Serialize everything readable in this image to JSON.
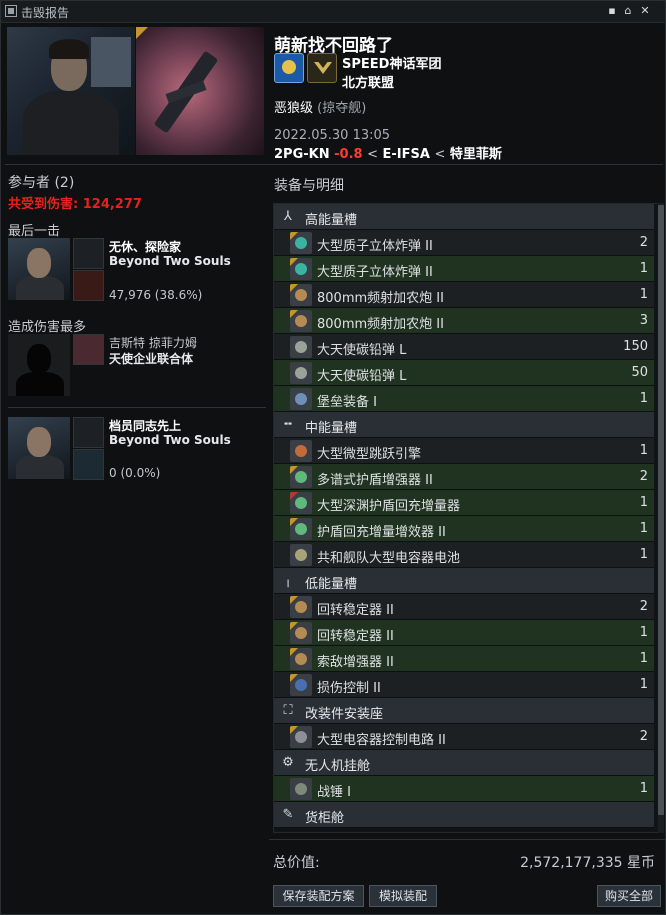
{
  "window": {
    "title": "击毁报告",
    "btn_min": "▪",
    "btn_lock": "⌂",
    "btn_close": "✕"
  },
  "victim": {
    "name": "萌新找不回路了",
    "corp": "SPEED神话军团",
    "alliance": "北方联盟",
    "ship": "恶狼级",
    "ship_class": "(掠夺舰)",
    "time": "2022.05.30 13:05",
    "system": "2PG-KN",
    "security": "-0.8",
    "region_path_1": "E-IFSA",
    "region_path_2": "特里菲斯",
    "sep": "<"
  },
  "participants": {
    "title": "参与者 (2)",
    "damage_total": "共受到伤害: 124,277",
    "final_blow_title": "最后一击",
    "final_blow": {
      "name": "无休、探险家",
      "corp": "Beyond Two Souls",
      "damage": "47,976 (38.6%)"
    },
    "top_damage_title": "造成伤害最多",
    "top_damage": {
      "name": "吉斯特 掠菲力姆",
      "corp": "天使企业联合体"
    },
    "third": {
      "name": "档员同志先上",
      "corp": "Beyond Two Souls",
      "damage": "0 (0.0%)"
    }
  },
  "fitting": {
    "title": "装备与明细",
    "sections": [
      {
        "label": "高能量槽",
        "icon": "high-slot-icon",
        "glyph": "⅄",
        "items": [
          {
            "name": "大型质子立体炸弹 II",
            "qty": "2",
            "green": false,
            "t2": true,
            "color": "#3bb3a1"
          },
          {
            "name": "大型质子立体炸弹 II",
            "qty": "1",
            "green": true,
            "t2": true,
            "color": "#3bb3a1"
          },
          {
            "name": "800mm频射加农炮 II",
            "qty": "1",
            "green": false,
            "t2": true,
            "color": "#b48a55"
          },
          {
            "name": "800mm频射加农炮 II",
            "qty": "3",
            "green": true,
            "t2": true,
            "color": "#b48a55"
          },
          {
            "name": "大天使碳铅弹 L",
            "qty": "150",
            "green": false,
            "t2": false,
            "color": "#9aa39a"
          },
          {
            "name": "大天使碳铅弹 L",
            "qty": "50",
            "green": true,
            "t2": false,
            "color": "#9aa39a"
          },
          {
            "name": "堡垒装备 I",
            "qty": "1",
            "green": true,
            "t2": false,
            "color": "#6e8fb8"
          }
        ]
      },
      {
        "label": "中能量槽",
        "icon": "mid-slot-icon",
        "glyph": "╍",
        "items": [
          {
            "name": "大型微型跳跃引擎",
            "qty": "1",
            "green": false,
            "t2": false,
            "color": "#c46a3b"
          },
          {
            "name": "多谱式护盾增强器 II",
            "qty": "2",
            "green": true,
            "t2": true,
            "color": "#5fb97c"
          },
          {
            "name": "大型深渊护盾回充增量器",
            "qty": "1",
            "green": true,
            "t2": false,
            "t3": true,
            "color": "#5fb97c"
          },
          {
            "name": "护盾回充增量增效器 II",
            "qty": "1",
            "green": true,
            "t2": true,
            "color": "#5fb97c"
          },
          {
            "name": "共和舰队大型电容器电池",
            "qty": "1",
            "green": false,
            "t2": false,
            "color": "#a9a37a"
          }
        ]
      },
      {
        "label": "低能量槽",
        "icon": "low-slot-icon",
        "glyph": "╷",
        "items": [
          {
            "name": "回转稳定器 II",
            "qty": "2",
            "green": false,
            "t2": true,
            "color": "#b48a55"
          },
          {
            "name": "回转稳定器 II",
            "qty": "1",
            "green": true,
            "t2": true,
            "color": "#b48a55"
          },
          {
            "name": "索敌增强器 II",
            "qty": "1",
            "green": true,
            "t2": true,
            "color": "#b48a55"
          },
          {
            "name": "损伤控制 II",
            "qty": "1",
            "green": false,
            "t2": true,
            "color": "#4a6fb0"
          }
        ]
      },
      {
        "label": "改装件安装座",
        "icon": "rig-slot-icon",
        "glyph": "⛶",
        "items": [
          {
            "name": "大型电容器控制电路 II",
            "qty": "2",
            "green": false,
            "t2": true,
            "color": "#8d9197"
          }
        ]
      },
      {
        "label": "无人机挂舱",
        "icon": "drone-bay-icon",
        "glyph": "⚙",
        "items": [
          {
            "name": "战锤 I",
            "qty": "1",
            "green": true,
            "t2": false,
            "color": "#7d8a7b"
          }
        ]
      },
      {
        "label": "货柜舱",
        "icon": "cargo-bay-icon",
        "glyph": "✎",
        "items": []
      }
    ]
  },
  "total": {
    "label": "总价值:",
    "value": "2,572,177,335 星币"
  },
  "buttons": {
    "save_fit": "保存装配方案",
    "simulate": "模拟装配",
    "buy_all": "购买全部"
  },
  "colors": {
    "security": "#ff3b30",
    "damage_total": "#e5221d",
    "green_row": "#203321",
    "tech2": "#c6952c"
  }
}
